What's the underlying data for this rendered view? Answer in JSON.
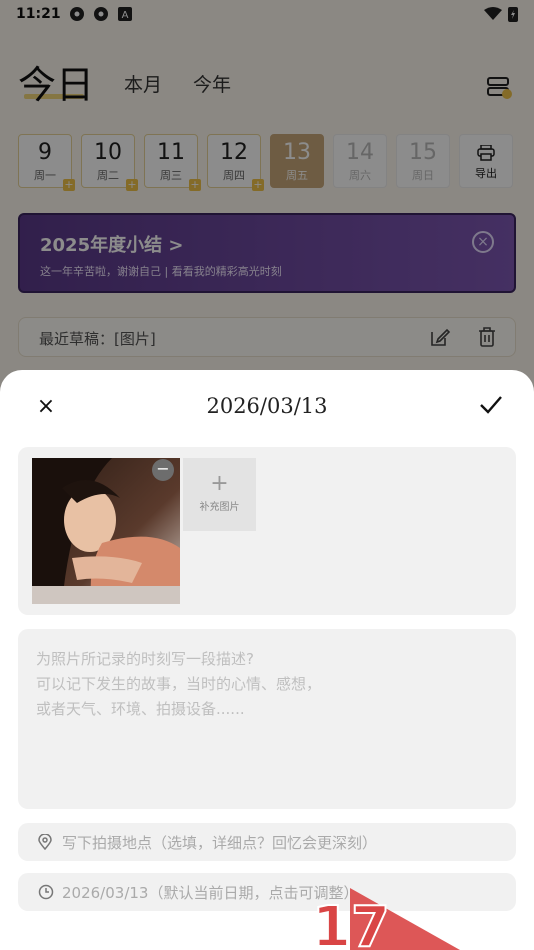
{
  "status_bar": {
    "time": "11:21"
  },
  "header": {
    "title": "今日",
    "tabs": [
      {
        "label": "本月"
      },
      {
        "label": "今年"
      }
    ]
  },
  "days": [
    {
      "num": "9",
      "label": "周一",
      "state": "past",
      "has_plus": true
    },
    {
      "num": "10",
      "label": "周二",
      "state": "past",
      "has_plus": true
    },
    {
      "num": "11",
      "label": "周三",
      "state": "past",
      "has_plus": true
    },
    {
      "num": "12",
      "label": "周四",
      "state": "past",
      "has_plus": true
    },
    {
      "num": "13",
      "label": "周五",
      "state": "active",
      "has_plus": false
    },
    {
      "num": "14",
      "label": "周六",
      "state": "future",
      "has_plus": false
    },
    {
      "num": "15",
      "label": "周日",
      "state": "future",
      "has_plus": false
    }
  ],
  "export": {
    "label": "导出"
  },
  "banner": {
    "title": "2025年度小结 >",
    "subtitle": "这一年辛苦啦，谢谢自己 | 看看我的精彩高光时刻"
  },
  "draft": {
    "text": "最近草稿：[图片]"
  },
  "sheet": {
    "date": "2026/03/13",
    "add_photo_label": "补充图片",
    "description_placeholder": [
      "为照片所记录的时刻写一段描述?",
      "可以记下发生的故事，当时的心情、感想，",
      "或者天气、环境、拍摄设备......"
    ],
    "location_placeholder": "写下拍摄地点（选填，详细点？回忆会更深刻）",
    "date_placeholder": "2026/03/13（默认当前日期，点击可调整）"
  },
  "watermark": {
    "text": "17"
  },
  "colors": {
    "accent_gold": "#c9a87a",
    "banner_purple": "#5b3a8a",
    "plus_yellow": "#f0c34a"
  }
}
